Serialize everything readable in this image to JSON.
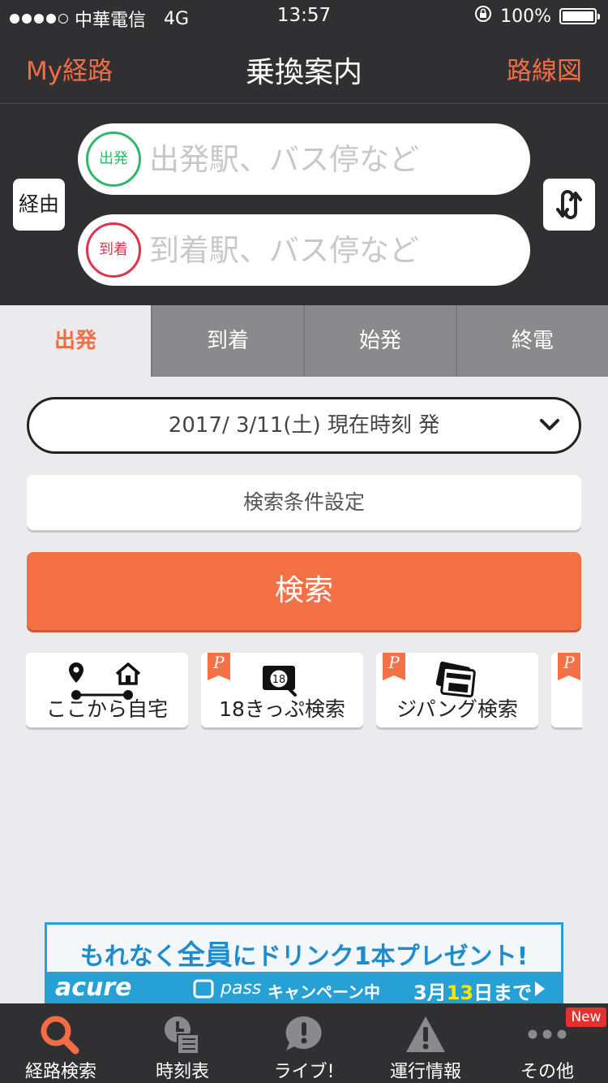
{
  "status_bar": {
    "carrier": "中華電信",
    "network": "4G",
    "time": "13:57",
    "battery": "100%"
  },
  "nav": {
    "left": "My経路",
    "title": "乗換案内",
    "right": "路線図"
  },
  "route_input": {
    "via_label": "経由",
    "from_badge": "出発",
    "from_placeholder": "出発駅、バス停など",
    "to_badge": "到着",
    "to_placeholder": "到着駅、バス停など"
  },
  "tabs": [
    {
      "label": "出発",
      "active": true
    },
    {
      "label": "到着",
      "active": false
    },
    {
      "label": "始発",
      "active": false
    },
    {
      "label": "終電",
      "active": false
    }
  ],
  "date_selector": "2017/ 3/11(土) 現在時刻 発",
  "conditions_label": "検索条件設定",
  "search_label": "検索",
  "shortcuts": [
    {
      "label": "ここから自宅",
      "icon": "route-home-icon",
      "premium": false
    },
    {
      "label": "18きっぷ検索",
      "icon": "18-ticket-search-icon",
      "premium": true
    },
    {
      "label": "ジパング検索",
      "icon": "zipangu-card-icon",
      "premium": true
    },
    {
      "label": "",
      "icon": "",
      "premium": true
    }
  ],
  "premium_badge": "P",
  "ad": {
    "headline_pre": "もれなく",
    "headline_em": "全員",
    "headline_post": "にドリンク1本プレゼント!",
    "brand": "acure",
    "pass": "pass",
    "campaign": "キャンペーン中",
    "date_pre": "3月",
    "date_em": "13",
    "date_post": "日まで"
  },
  "tab_bar": [
    {
      "label": "経路検索",
      "icon": "search-icon",
      "active": true
    },
    {
      "label": "時刻表",
      "icon": "timetable-icon",
      "active": false
    },
    {
      "label": "ライブ!",
      "icon": "live-icon",
      "active": false
    },
    {
      "label": "運行情報",
      "icon": "warning-icon",
      "active": false
    },
    {
      "label": "その他",
      "icon": "more-icon",
      "active": false
    }
  ],
  "new_badge": "New",
  "colors": {
    "accent": "#f26d44",
    "dark_bar": "#303033",
    "background": "#ebebee",
    "from_green": "#2fb86a",
    "to_red": "#e0334c"
  }
}
